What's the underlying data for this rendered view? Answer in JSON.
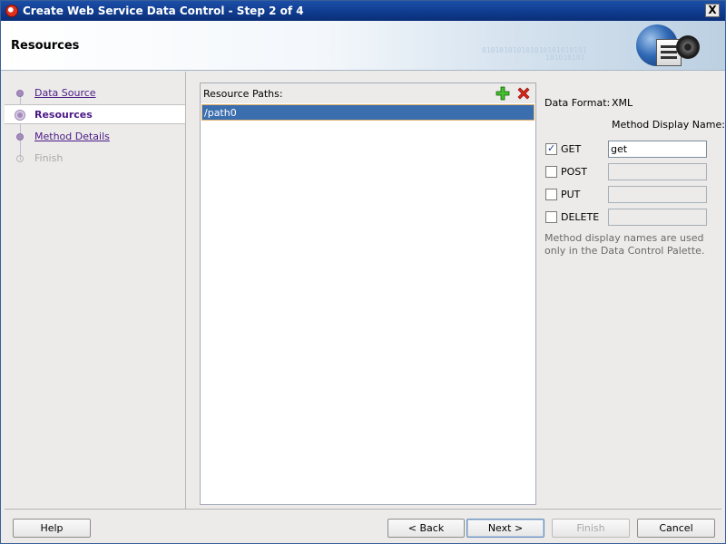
{
  "window": {
    "title": "Create Web Service Data Control - Step 2 of 4",
    "close_symbol": "X"
  },
  "header": {
    "title": "Resources",
    "binary_line_1": "010101010101010101010101",
    "binary_line_2": "101010101"
  },
  "nav": {
    "items": [
      {
        "label": "Data Source",
        "state": "link"
      },
      {
        "label": "Resources",
        "state": "current"
      },
      {
        "label": "Method Details",
        "state": "link"
      },
      {
        "label": "Finish",
        "state": "disabled"
      }
    ]
  },
  "resources": {
    "label": "Resource Paths:",
    "paths": [
      "/path0"
    ],
    "add_icon": "plus-icon",
    "remove_icon": "x-icon"
  },
  "form": {
    "data_format_label": "Data Format:",
    "data_format_value": "XML",
    "method_display_name_label": "Method Display Name:",
    "methods": [
      {
        "label": "GET",
        "checked": true,
        "display_name": "get",
        "enabled": true
      },
      {
        "label": "POST",
        "checked": false,
        "display_name": "",
        "enabled": false
      },
      {
        "label": "PUT",
        "checked": false,
        "display_name": "",
        "enabled": false
      },
      {
        "label": "DELETE",
        "checked": false,
        "display_name": "",
        "enabled": false
      }
    ],
    "note": "Method display names are used only in the Data Control Palette."
  },
  "buttons": {
    "help": "Help",
    "back": "< Back",
    "next": "Next >",
    "finish": "Finish",
    "cancel": "Cancel"
  },
  "colors": {
    "title_bar": "#0f3a8c",
    "selection": "#3b6eae",
    "nav_link": "#4b1a87"
  }
}
